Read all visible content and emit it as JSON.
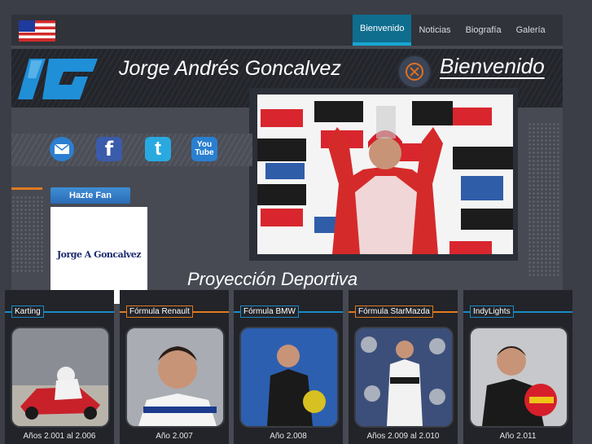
{
  "nav": {
    "items": [
      "Bienvenido",
      "Noticias",
      "Biografía",
      "Galería"
    ],
    "active": "Bienvenido"
  },
  "header": {
    "name": "Jorge Andrés Goncalvez",
    "welcome": "Bienvenido"
  },
  "social": {
    "icons": [
      "email-icon",
      "facebook-icon",
      "twitter-icon",
      "youtube-icon"
    ],
    "youtube_text": "You Tube"
  },
  "fan": {
    "button_label": "Hazte Fan",
    "box_text": "Jorge A Goncalvez"
  },
  "section": {
    "title": "Proyección Deportiva"
  },
  "careers": [
    {
      "label": "Karting",
      "years": "Años 2.001 al 2.006"
    },
    {
      "label": "Fórmula Renault",
      "years": "Año 2.007"
    },
    {
      "label": "Fórmula BMW",
      "years": "Año 2.008"
    },
    {
      "label": "Fórmula StarMazda",
      "years": "Años 2.009 al 2.010"
    },
    {
      "label": "IndyLights",
      "years": "Año 2.011"
    }
  ],
  "colors": {
    "accent_blue": "#1b8ac4",
    "accent_orange": "#e07a1f",
    "nav_active": "#0f6d8e"
  }
}
